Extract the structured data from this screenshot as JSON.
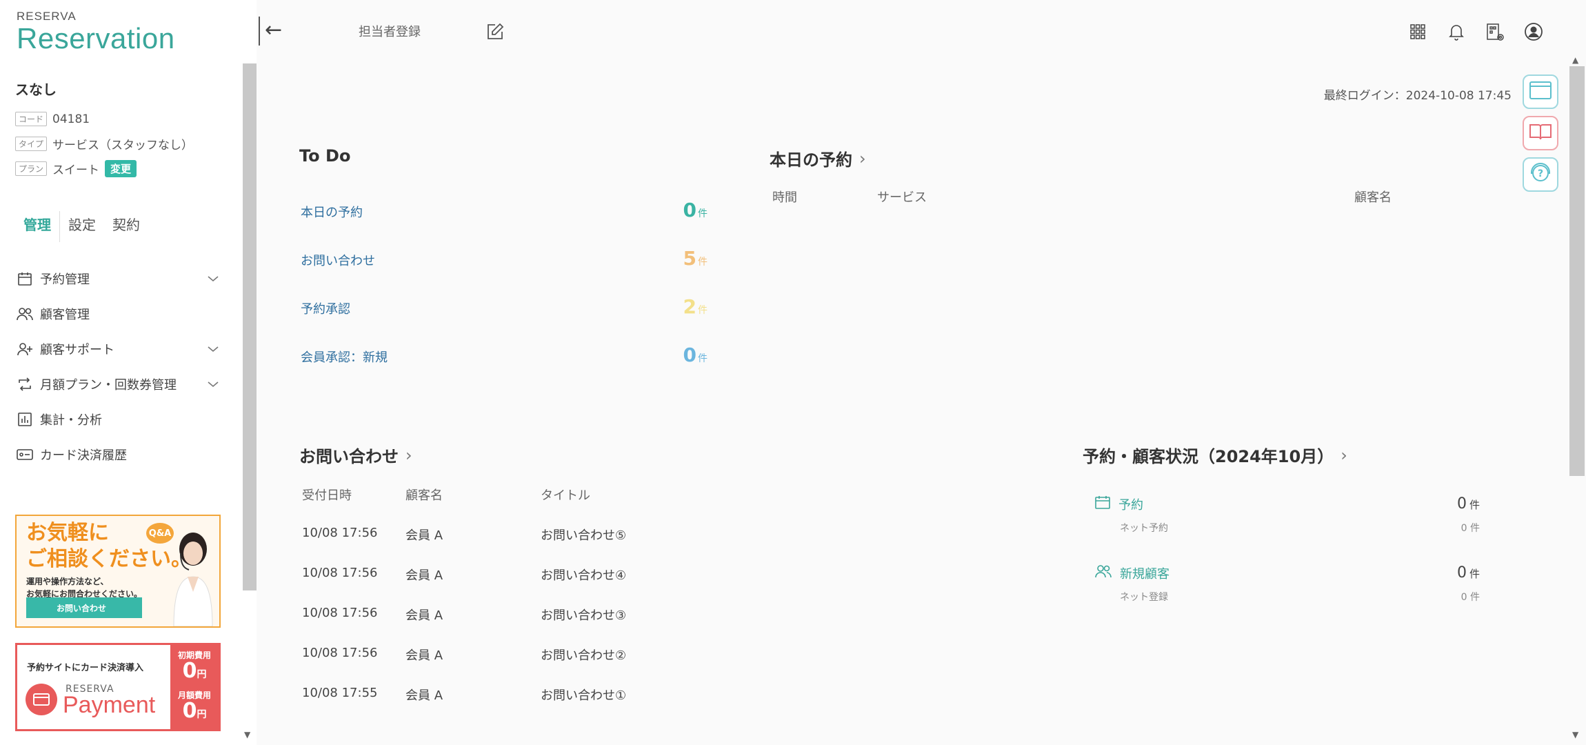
{
  "sidebar": {
    "logo_small": "RESERVA",
    "logo_big": "Reservation",
    "org_name": "スなし",
    "meta": {
      "code_tag": "コード",
      "code_value": "04181",
      "type_tag": "タイプ",
      "type_value": "サービス（スタッフなし）",
      "plan_tag": "プラン",
      "plan_value": "スイート",
      "plan_change": "変更"
    },
    "tabs": [
      "管理",
      "設定",
      "契約"
    ],
    "nav": [
      {
        "label": "予約管理",
        "icon": "calendar-icon",
        "expandable": true
      },
      {
        "label": "顧客管理",
        "icon": "users-icon",
        "expandable": false
      },
      {
        "label": "顧客サポート",
        "icon": "user-plus-icon",
        "expandable": true
      },
      {
        "label": "月額プラン・回数券管理",
        "icon": "repeat-icon",
        "expandable": true
      },
      {
        "label": "集計・分析",
        "icon": "bar-chart-icon",
        "expandable": false
      },
      {
        "label": "カード決済履歴",
        "icon": "card-icon",
        "expandable": false
      }
    ],
    "banner1": {
      "title_line1": "お気軽に",
      "title_line2": "ご相談ください。",
      "sub_line1": "運用や操作方法など、",
      "sub_line2": "お気軽にお問合わせください。",
      "button": "お問い合わせ",
      "bubble": "Q&A"
    },
    "banner2": {
      "title": "予約サイトにカード決済導入",
      "brand_small": "RESERVA",
      "brand_big": "Payment",
      "fee1_label": "初期費用",
      "fee1_value": "0",
      "fee2_label": "月額費用",
      "fee2_value": "0",
      "currency": "円"
    }
  },
  "header": {
    "back_arrow": "←",
    "staff_register": "担当者登録",
    "icons": [
      "apps-grid-icon",
      "bell-icon",
      "building-settings-icon",
      "account-icon"
    ]
  },
  "last_login": "最終ログイン：2024-10-08 17:45",
  "todo": {
    "title": "To Do",
    "unit": "件",
    "items": [
      {
        "label": "本日の予約",
        "count": "0",
        "color": "#3ab3a3"
      },
      {
        "label": "お問い合わせ",
        "count": "5",
        "color": "#f2bf7a"
      },
      {
        "label": "予約承認",
        "count": "2",
        "color": "#f3e08a"
      },
      {
        "label": "会員承認：新規",
        "count": "0",
        "color": "#6bb5de"
      }
    ]
  },
  "today": {
    "title": "本日の予約",
    "columns": [
      "時間",
      "サービス",
      "顧客名"
    ]
  },
  "inquiries": {
    "title": "お問い合わせ",
    "columns": [
      "受付日時",
      "顧客名",
      "タイトル"
    ],
    "rows": [
      {
        "date": "10/08 17:56",
        "customer": "会員 A",
        "title": "お問い合わせ⑤"
      },
      {
        "date": "10/08 17:56",
        "customer": "会員 A",
        "title": "お問い合わせ④"
      },
      {
        "date": "10/08 17:56",
        "customer": "会員 A",
        "title": "お問い合わせ③"
      },
      {
        "date": "10/08 17:56",
        "customer": "会員 A",
        "title": "お問い合わせ②"
      },
      {
        "date": "10/08 17:55",
        "customer": "会員 A",
        "title": "お問い合わせ①"
      }
    ]
  },
  "status": {
    "title": "予約・顧客状況（2024年10月）",
    "unit": "件",
    "items": [
      {
        "label": "予約",
        "count": "0",
        "sub_label": "ネット予約",
        "sub_count": "0",
        "icon": "calendar-icon"
      },
      {
        "label": "新規顧客",
        "count": "0",
        "sub_label": "ネット登録",
        "sub_count": "0",
        "icon": "users-icon"
      }
    ]
  },
  "colors": {
    "brand": "#3aa69a",
    "accent_button": "#33b9a7",
    "inquiry_orange": "#f2bf7a",
    "approval_yellow": "#f3e08a",
    "member_blue": "#6bb5de",
    "payment_red": "#e85a5a"
  }
}
